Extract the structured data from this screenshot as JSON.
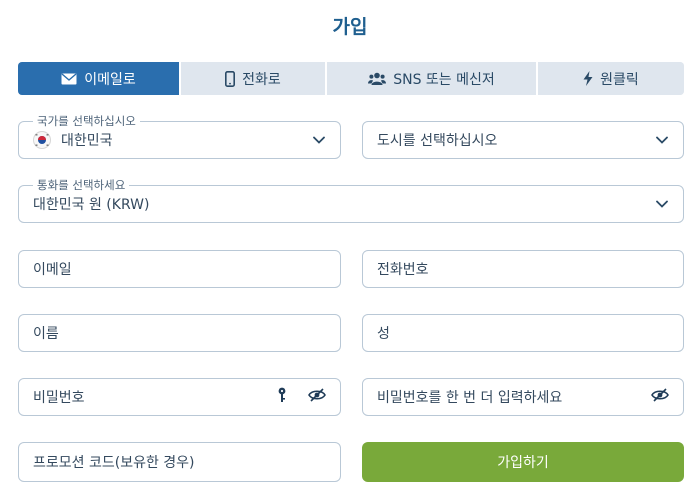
{
  "page": {
    "title": "가입"
  },
  "tabs": [
    {
      "label": "이메일로",
      "icon": "envelope-icon",
      "active": true
    },
    {
      "label": "전화로",
      "icon": "mobile-phone-icon",
      "active": false
    },
    {
      "label": "SNS 또는 메신저",
      "icon": "users-icon",
      "active": false
    },
    {
      "label": "원클릭",
      "icon": "lightning-icon",
      "active": false
    }
  ],
  "form": {
    "country": {
      "label": "국가를 선택하십시오",
      "value": "대한민국",
      "icon": "south-korea-flag-icon"
    },
    "city": {
      "placeholder": "도시를 선택하십시오"
    },
    "currency": {
      "label": "통화를 선택하세요",
      "value": "대한민국 원 (KRW)"
    },
    "email": {
      "placeholder": "이메일"
    },
    "phone": {
      "placeholder": "전화번호"
    },
    "first_name": {
      "placeholder": "이름"
    },
    "last_name": {
      "placeholder": "성"
    },
    "password": {
      "placeholder": "비밀번호"
    },
    "password_repeat": {
      "placeholder": "비밀번호를 한 번 더 입력하세요"
    },
    "promo": {
      "placeholder": "프로모션 코드(보유한 경우)"
    },
    "submit_label": "가입하기"
  },
  "colors": {
    "accent": "#2a6eae",
    "submit": "#79a93a",
    "title": "#1f5f8f",
    "border": "#b9c8d6"
  }
}
